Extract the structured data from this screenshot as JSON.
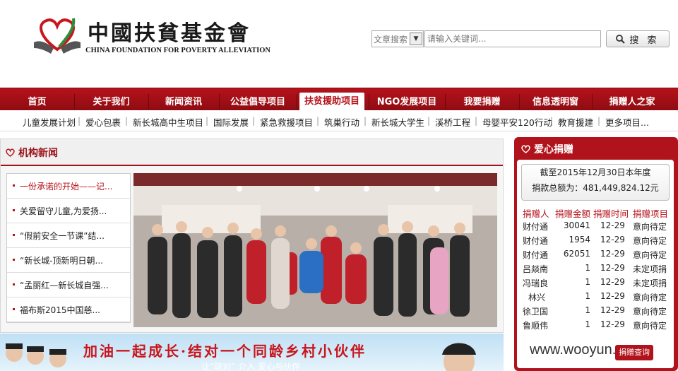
{
  "header": {
    "logo_cn": "中國扶貧基金會",
    "logo_en": "CHINA FOUNDATION FOR POVERTY ALLEVIATION",
    "search_select": "文章搜索",
    "search_placeholder": "请输入关键词...",
    "search_button": "搜 索"
  },
  "nav": [
    "首页",
    "关于我们",
    "新闻资讯",
    "公益倡导项目",
    "扶贫援助项目",
    "NGO发展项目",
    "我要捐赠",
    "信息透明窗",
    "捐赠人之家"
  ],
  "nav_active_index": 4,
  "subnav": [
    "儿童发展计划",
    "爱心包裹",
    "新长城高中生项目",
    "国际发展",
    "紧急救援项目",
    "筑巢行动",
    "新长城大学生",
    "溪桥工程",
    "母婴平安120行动",
    "教育援建",
    "更多项目..."
  ],
  "news": {
    "title": "机构新闻",
    "items": [
      "一份承诺的开始——记...",
      "关爱留守儿童,为爱扬...",
      "“假前安全一节课”结...",
      "“新长城-顶新明日朝...",
      "“孟丽红—新长城自强...",
      "福布斯2015中国慈..."
    ]
  },
  "banner": {
    "text": "加油一起成长·结对一个同龄乡村小伙伴",
    "sub": "让“联对” 介入 爱心与伙伴"
  },
  "donations": {
    "title": "爱心捐赠",
    "summary_line1": "截至2015年12月30日本年度",
    "summary_line2": "捐款总额为：481,449,824.12元",
    "headers": [
      "捐赠人",
      "捐赠金额",
      "捐赠时间",
      "捐赠项目"
    ],
    "rows": [
      [
        "财付通",
        "30041",
        "12-29",
        "意向待定"
      ],
      [
        "财付通",
        "1954",
        "12-29",
        "意向待定"
      ],
      [
        "财付通",
        "62051",
        "12-29",
        "意向待定"
      ],
      [
        "吕燚南",
        "1",
        "12-29",
        "未定项捐"
      ],
      [
        "冯瑞良",
        "1",
        "12-29",
        "未定项捐"
      ],
      [
        "林兴",
        "1",
        "12-29",
        "意向待定"
      ],
      [
        "徐卫国",
        "1",
        "12-29",
        "意向待定"
      ],
      [
        "鲁顺伟",
        "1",
        "12-29",
        "意向待定"
      ]
    ]
  },
  "watermark": "www.wooyun.org",
  "watermark_btn": "捐赠查询",
  "colors": {
    "brand_red": "#b5121b",
    "dark_red": "#8f0c12"
  }
}
